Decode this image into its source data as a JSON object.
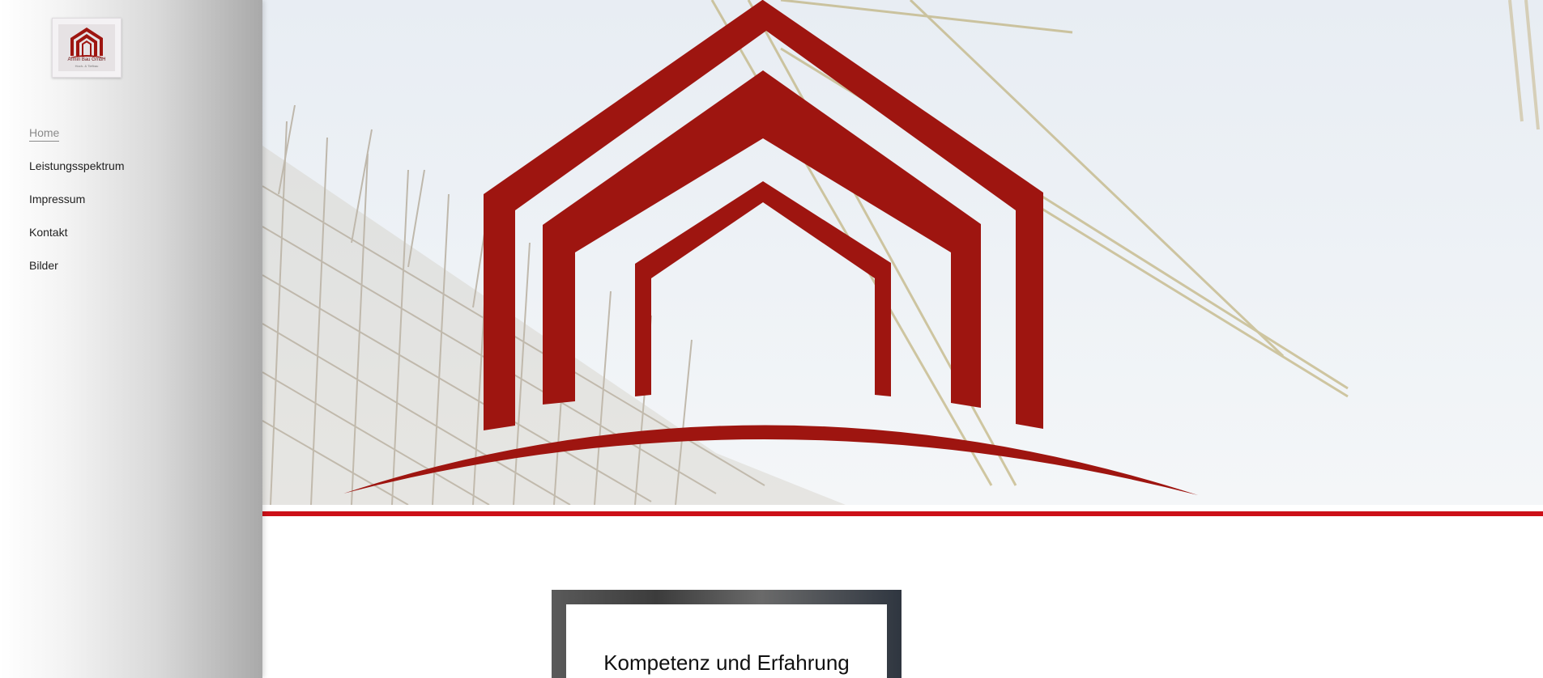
{
  "logo": {
    "company_name": "Armin Bau GmbH",
    "tagline": "Hoch- & Tiefbau",
    "icon": "house-logo-icon"
  },
  "nav": {
    "items": [
      {
        "label": "Home",
        "active": true
      },
      {
        "label": "Leistungsspektrum",
        "active": false
      },
      {
        "label": "Impressum",
        "active": false
      },
      {
        "label": "Kontakt",
        "active": false
      },
      {
        "label": "Bilder",
        "active": false
      }
    ]
  },
  "hero": {
    "image": "construction-site-with-crane",
    "logo_icon": "house-logo-icon"
  },
  "content": {
    "card_title": "Kompetenz und Erfahrung"
  },
  "colors": {
    "brand_red": "#9e1510",
    "accent_line": "#cc1018",
    "sidebar_gray": "#a9a9a9"
  }
}
